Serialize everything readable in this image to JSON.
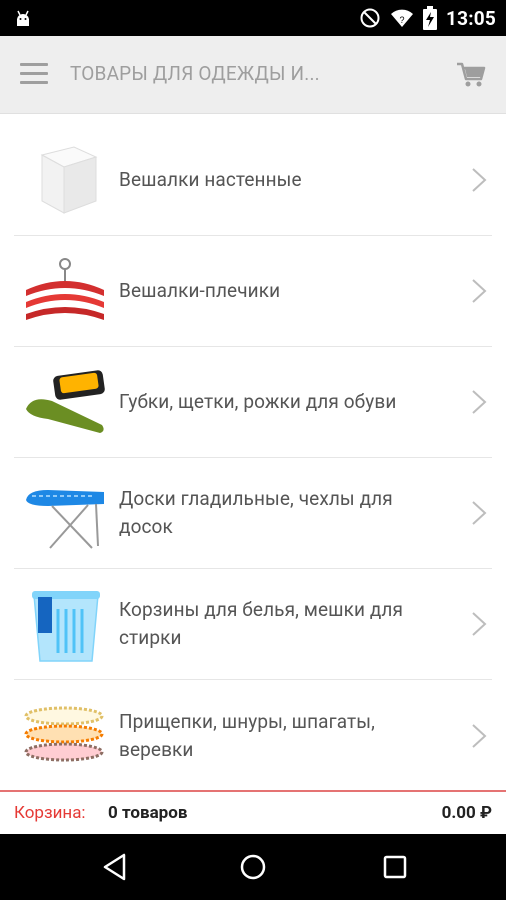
{
  "status_bar": {
    "time": "13:05",
    "icons": [
      "android-debug-icon",
      "do-not-disturb-icon",
      "wifi-icon",
      "battery-charging-icon"
    ]
  },
  "toolbar": {
    "title": "ТОВАРЫ ДЛЯ ОДЕЖДЫ И...",
    "menu_icon": "hamburger-menu-icon",
    "cart_icon": "shopping-cart-icon"
  },
  "categories": [
    {
      "label": "Вешалки настенные",
      "thumb": "wall-hanger-image"
    },
    {
      "label": "Вешалки-плечики",
      "thumb": "clothes-hangers-image"
    },
    {
      "label": "Губки, щетки, рожки для обуви",
      "thumb": "shoe-care-image"
    },
    {
      "label": "Доски гладильные, чехлы для досок",
      "thumb": "ironing-board-image"
    },
    {
      "label": "Корзины для белья, мешки для стирки",
      "thumb": "laundry-basket-image"
    },
    {
      "label": "Прищепки, шнуры, шпагаты, веревки",
      "thumb": "clothespins-ropes-image"
    }
  ],
  "cart": {
    "label": "Корзина:",
    "count": "0 товаров",
    "total": "0.00 ₽"
  },
  "colors": {
    "accent": "#e53935",
    "toolbar_bg": "#eeeeee",
    "text": "#555555"
  }
}
